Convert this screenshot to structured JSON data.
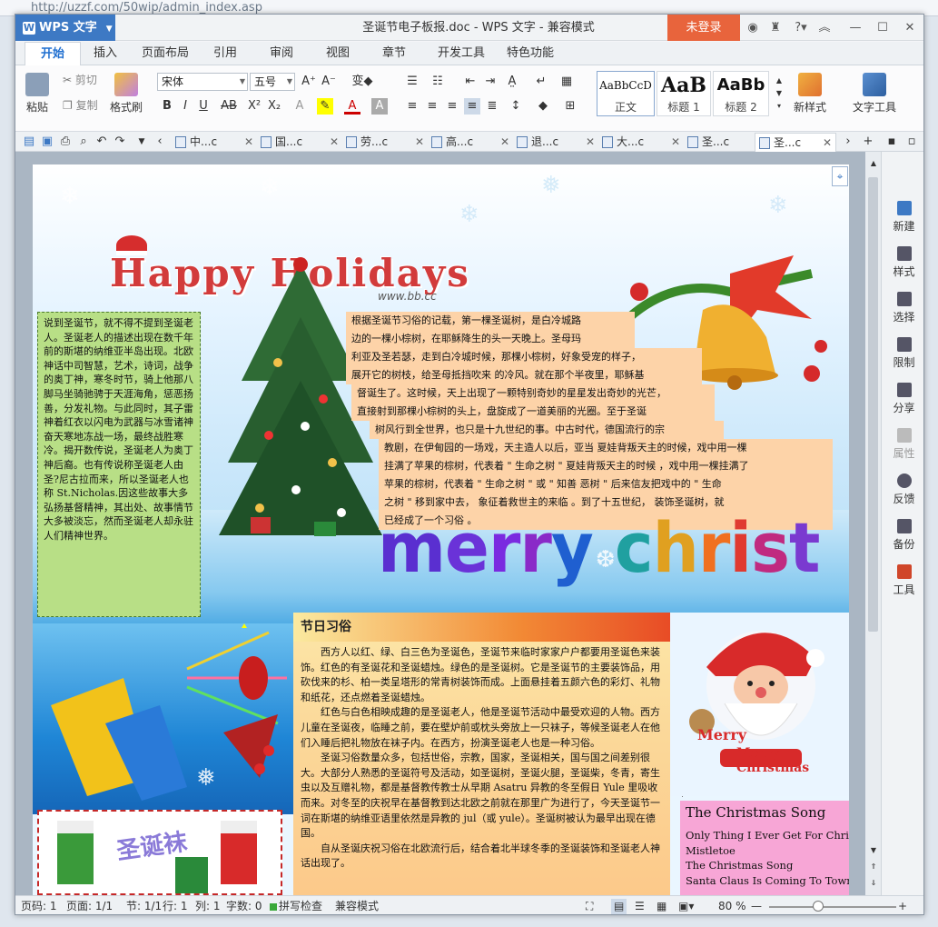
{
  "browser": {
    "address": "http://uzzf.com/50wip/admin_index.asp"
  },
  "app": {
    "name": "WPS 文字",
    "logo_letter": "W",
    "doc_title": "圣诞节电子板报.doc - WPS 文字 - 兼容模式",
    "login": "未登录"
  },
  "menu": [
    "开始",
    "插入",
    "页面布局",
    "引用",
    "审阅",
    "视图",
    "章节",
    "开发工具",
    "特色功能"
  ],
  "ribbon": {
    "paste": "粘贴",
    "cut": "剪切",
    "copy": "复制",
    "format_painter": "格式刷",
    "font_name": "宋体",
    "font_size": "五号",
    "styles": [
      {
        "sample": "AaBbCcD",
        "label": "正文"
      },
      {
        "sample": "AaB",
        "label": "标题 1"
      },
      {
        "sample": "AaBb",
        "label": "标题 2"
      }
    ],
    "new_style": "新样式",
    "text_tools": "文字工具"
  },
  "doc_tabs": [
    "中...c",
    "国...c",
    "劳...c",
    "高...c",
    "退...c",
    "大...c",
    "圣...c",
    "圣...c"
  ],
  "right_panel": [
    "新建",
    "样式",
    "选择",
    "限制",
    "分享",
    "属性",
    "反馈",
    "备份",
    "工具"
  ],
  "status": {
    "page_num": "页码: 1",
    "pages": "页面: 1/1",
    "section": "节: 1/1",
    "row": "行: 1",
    "col": "列: 1",
    "word_count": "字数: 0",
    "spell": "拼写检查",
    "compat": "兼容模式",
    "zoom": "80 %"
  },
  "page": {
    "happy": "Happy Holidays",
    "watermark": "www.bb.cc",
    "merry": "merry christmas",
    "sock_title": "圣诞袜",
    "left_box": "说到圣诞节，就不得不提到圣诞老人。圣诞老人的描述出现在数千年前的斯堪的纳维亚半岛出现。北欧神话中司智慧，艺术，诗词，战争的奥丁神，寒冬时节，骑上他那八脚马坐骑驰骋于天涯海角，惩恶扬善，分发礼物。与此同时，其子雷神着红衣以闪电为武器与冰雪诸神奋天寒地冻战一场，最终战胜寒冷。揭开数传说，圣诞老人为奥丁神后裔。也有传说称圣诞老人由圣?尼古拉而来，所以圣诞老人也称 St.Nicholas.因这些故事大多弘扬基督精神，其出处、故事情节大多被淡忘，然而圣诞老人却永驻人们精神世界。",
    "top_lines": [
      "根据圣诞节习俗的记载，第一棵圣诞树，是白冷城路",
      "边的一棵小棕树，在耶稣降生的头一天晚上。圣母玛",
      "利亚及圣若瑟，走到白冷城时候，那棵小棕树，好象受宠的样子，",
      "展开它的树枝，给圣母抵挡吹来 的冷风。就在那个半夜里，耶稣基",
      "督诞生了。这时候，天上出现了一颗特别奇妙的星星发出奇妙的光芒，",
      "直接射到那棵小棕树的头上，盘旋成了一道美丽的光圈。至于圣诞",
      "树风行到全世界，也只是十九世纪的事。中古时代，德国流行的宗",
      "教剧，在伊甸园的一场戏，天主造人以后，亚当 夏娃背叛天主的时候，戏中用一棵",
      "挂满了苹果的棕树，代表着 \" 生命之树 \" 夏娃背叛天主的时候 ，戏中用一棵挂满了",
      "苹果的棕树，代表着 \" 生命之树 \" 或 \" 知善 恶树 \" 后来信友把戏中的 \" 生命",
      "之树 \" 移到家中去， 象征着救世主的来临 。到了十五世纪， 装饰圣诞树，就",
      "已经成了一个习俗 。"
    ],
    "mid_heading": "节日习俗",
    "mid_paras": [
      "西方人以红、绿、白三色为圣诞色，圣诞节来临时家家户户都要用圣诞色来装饰。红色的有圣诞花和圣诞蜡烛。绿色的是圣诞树。它是圣诞节的主要装饰品，用砍伐来的杉、柏一类呈塔形的常青树装饰而成。上面悬挂着五颜六色的彩灯、礼物和纸花，还点燃着圣诞蜡烛。",
      "红色与白色相映成趣的是圣诞老人，他是圣诞节活动中最受欢迎的人物。西方儿童在圣诞夜，临睡之前，要在壁炉前或枕头旁放上一只袜子，等候圣诞老人在他们入睡后把礼物放在袜子内。在西方，扮演圣诞老人也是一种习俗。",
      "圣诞习俗数量众多，包括世俗，宗教，国家，圣诞相关，国与国之间差别很大。大部分人熟悉的圣诞符号及活动，如圣诞树，圣诞火腿，圣诞柴，冬青，寄生虫以及互赠礼物，都是基督教传教士从早期 Asatru 异教的冬至假日 Yule 里吸收而来。对冬至的庆祝早在基督教到达北欧之前就在那里广为进行了，今天圣诞节一词在斯堪的纳维亚语里依然是异教的 jul（或 yule）。圣诞树被认为最早出现在德国。",
      "自从圣诞庆祝习俗在北欧流行后，结合着北半球冬季的圣诞装饰和圣诞老人神话出现了。"
    ],
    "santa_text": "Merry Christmas",
    "song_title": "The Christmas Song",
    "songs": [
      "Only Thing I Ever Get For Christ",
      "Mistletoe",
      "The Christmas Song",
      "Santa Claus Is Coming To Town"
    ]
  },
  "colors": {
    "wps_blue": "#3d79c4",
    "login_orange": "#e8643c",
    "left_box_green": "#b8df86",
    "top_box_peach": "#fdd3a8",
    "song_pink": "#f7a6d6"
  }
}
